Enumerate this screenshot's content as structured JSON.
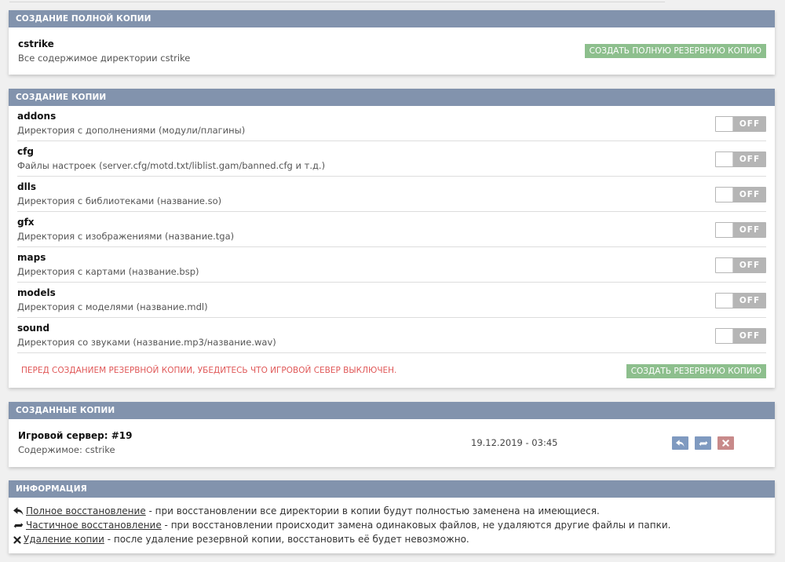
{
  "full_backup": {
    "header": "Создание полной копии",
    "item_name": "cstrike",
    "item_desc": "Все содержимое директории cstrike",
    "button_label": "Создать полную резервную копию"
  },
  "partial_backup": {
    "header": "Создание копии",
    "items": [
      {
        "name": "addons",
        "desc": "Директория с дополнениями (модули/плагины)",
        "state": "OFF"
      },
      {
        "name": "cfg",
        "desc": "Файлы настроек (server.cfg/motd.txt/liblist.gam/banned.cfg и т.д.)",
        "state": "OFF"
      },
      {
        "name": "dlls",
        "desc": "Директория с библиотеками (название.so)",
        "state": "OFF"
      },
      {
        "name": "gfx",
        "desc": "Директория с изображениями (название.tga)",
        "state": "OFF"
      },
      {
        "name": "maps",
        "desc": "Директория с картами (название.bsp)",
        "state": "OFF"
      },
      {
        "name": "models",
        "desc": "Директория с моделями (название.mdl)",
        "state": "OFF"
      },
      {
        "name": "sound",
        "desc": "Директория со звуками (название.mp3/название.wav)",
        "state": "OFF"
      }
    ],
    "warning": "Перед созданием резервной копии, убедитесь что игровой север выключен.",
    "button_label": "Создать резервную копию"
  },
  "created_backups": {
    "header": "Созданные копии",
    "items": [
      {
        "title": "Игровой сервер: #19",
        "content": "Содержимое: cstrike",
        "date": "19.12.2019 - 03:45"
      }
    ]
  },
  "info": {
    "header": "Информация",
    "lines": [
      {
        "link": "Полное восстановление",
        "text": " - при восстановлении все директории в копии будут полностью заменена на имеющиеся.",
        "icon": "reply-icon"
      },
      {
        "link": "Частичное восстановление",
        "text": " - при восстановлении происходит замена одинаковых файлов, не удаляются другие файлы и папки.",
        "icon": "refresh-icon"
      },
      {
        "link": "Удаление копии",
        "text": " - после удаление резервной копии, восстановить её будет невозможно.",
        "icon": "close-icon"
      }
    ]
  },
  "colors": {
    "header_bg": "#8293ad",
    "green_button": "#8dbf8d",
    "toggle_off": "#b5b5b5",
    "warning": "#e05858",
    "restore_btn": "#7f9ac0",
    "delete_btn": "#c88a8a"
  }
}
